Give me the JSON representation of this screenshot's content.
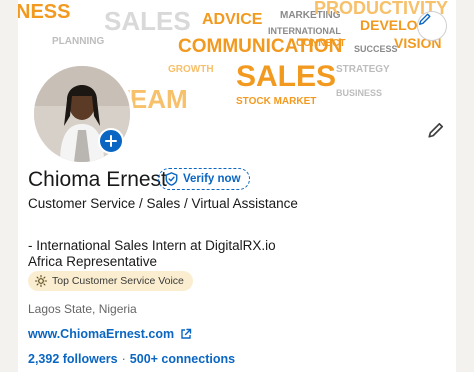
{
  "banner": {
    "words": [
      "NESS",
      "SALES",
      "ADVICE",
      "COMMUNICATION",
      "SALES",
      "PRODUCTIVITY",
      "CONNECT",
      "DEVELOP",
      "VISION",
      "TEAM",
      "MARKETING",
      "INTERNATIONAL",
      "SUCCESS",
      "PLANNING",
      "GROWTH",
      "STRATEGY",
      "STOCK MARKET",
      "BUSINESS"
    ],
    "colors": {
      "orange": "#f29a1f",
      "light_orange": "#f7c06a",
      "grey": "#8a8a8a",
      "light_grey": "#bdbdbd"
    }
  },
  "profile": {
    "name": "Chioma Ernest",
    "verify_label": "Verify now",
    "headline": "Customer Service / Sales / Virtual Assistance",
    "experience_line_1": "- International Sales Intern at DigitalRX.io",
    "experience_line_2": "Africa Representative",
    "badge_label": "Top Customer Service Voice",
    "location": "Lagos State, Nigeria",
    "website": "www.ChiomaErnest.com",
    "followers": "2,392 followers",
    "separator": "·",
    "connections": "500+ connections"
  },
  "icons": {
    "banner_edit": "pencil-icon",
    "profile_edit": "pencil-icon",
    "avatar_add": "plus-icon",
    "verify": "shield-check-icon",
    "badge": "sun-icon",
    "website": "external-link-icon"
  },
  "colors": {
    "brand_blue": "#0a66c2",
    "badge_bg": "#fbeed0",
    "text": "#191919",
    "muted": "#666666"
  }
}
